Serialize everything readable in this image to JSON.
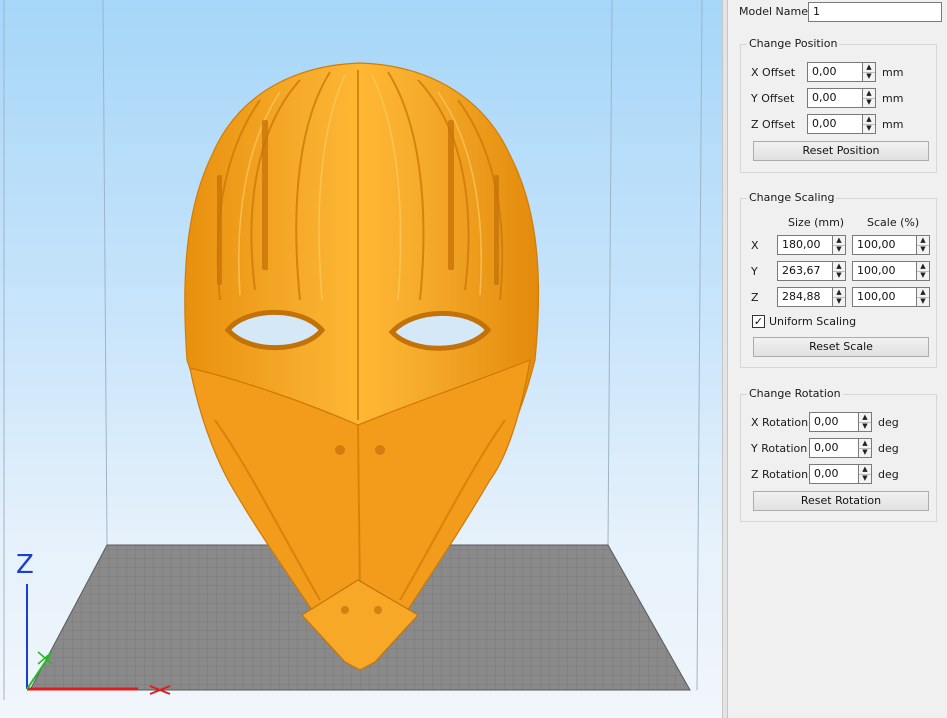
{
  "viewport": {
    "axis_z_label": "Z",
    "colors": {
      "model": "#f5a623",
      "bed": "#8c8c8c",
      "axis_z": "#1a3fd0",
      "axis_x": "#dd1e1e",
      "axis_y": "#22bb22"
    }
  },
  "panel": {
    "model_name_label": "Model Name:",
    "model_name_value": "1",
    "position": {
      "title": "Change Position",
      "x_label": "X Offset",
      "x_value": "0,00",
      "x_unit": "mm",
      "y_label": "Y Offset",
      "y_value": "0,00",
      "y_unit": "mm",
      "z_label": "Z Offset",
      "z_value": "0,00",
      "z_unit": "mm",
      "reset": "Reset Position"
    },
    "scaling": {
      "title": "Change Scaling",
      "size_header": "Size (mm)",
      "scale_header": "Scale (%)",
      "rows": [
        {
          "axis": "X",
          "size": "180,00",
          "scale": "100,00"
        },
        {
          "axis": "Y",
          "size": "263,67",
          "scale": "100,00"
        },
        {
          "axis": "Z",
          "size": "284,88",
          "scale": "100,00"
        }
      ],
      "uniform_label": "Uniform Scaling",
      "uniform_checked": "✓",
      "reset": "Reset Scale"
    },
    "rotation": {
      "title": "Change Rotation",
      "x_label": "X Rotation",
      "x_value": "0,00",
      "x_unit": "deg",
      "y_label": "Y Rotation",
      "y_value": "0,00",
      "y_unit": "deg",
      "z_label": "Z Rotation",
      "z_value": "0,00",
      "z_unit": "deg",
      "reset": "Reset Rotation"
    }
  }
}
